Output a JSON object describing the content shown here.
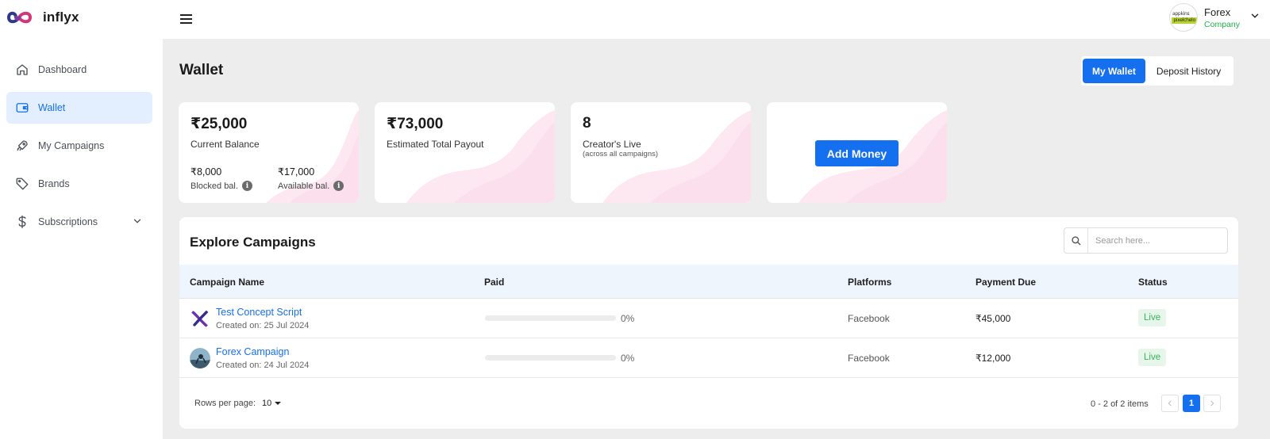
{
  "app": {
    "logo_text": "inflyx"
  },
  "sidebar": {
    "items": [
      {
        "label": "Dashboard",
        "icon": "home-icon"
      },
      {
        "label": "Wallet",
        "icon": "wallet-icon",
        "active": true
      },
      {
        "label": "My Campaigns",
        "icon": "rocket-icon"
      },
      {
        "label": "Brands",
        "icon": "tag-icon"
      },
      {
        "label": "Subscriptions",
        "icon": "dollar-icon",
        "expandable": true
      }
    ]
  },
  "user": {
    "name": "Forex",
    "role": "Company",
    "avatar_text_top": "appkins",
    "avatar_text_bottom": "pixelchelo"
  },
  "page": {
    "title": "Wallet",
    "tabs": [
      "My Wallet",
      "Deposit History"
    ],
    "active_tab": "My Wallet"
  },
  "stats": {
    "balance": {
      "amount": "₹25,000",
      "label": "Current Balance",
      "blocked_value": "₹8,000",
      "blocked_label": "Blocked bal.",
      "available_value": "₹17,000",
      "available_label": "Available bal."
    },
    "payout": {
      "amount": "₹73,000",
      "label": "Estimated Total Payout"
    },
    "creators": {
      "amount": "8",
      "label": "Creator's Live",
      "sub": "(across all campaigns)"
    },
    "add_money_label": "Add Money"
  },
  "campaigns": {
    "title": "Explore Campaigns",
    "search_placeholder": "Search here...",
    "columns": [
      "Campaign Name",
      "Paid",
      "Platforms",
      "Payment Due",
      "Status"
    ],
    "rows": [
      {
        "name": "Test Concept Script",
        "created": "Created on: 25 Jul 2024",
        "paid_pct": "0%",
        "paid_fraction": 0,
        "platform": "Facebook",
        "due": "₹45,000",
        "status": "Live"
      },
      {
        "name": "Forex Campaign",
        "created": "Created on: 24 Jul 2024",
        "paid_pct": "0%",
        "paid_fraction": 0,
        "platform": "Facebook",
        "due": "₹12,000",
        "status": "Live"
      }
    ],
    "rows_per_page_label": "Rows per page:",
    "rows_per_page": "10",
    "pager_info": "0 - 2  of 2 items",
    "current_page": "1"
  },
  "colors": {
    "accent": "#1570ef",
    "status_live_bg": "#e6f6ea",
    "status_live_fg": "#36b45a",
    "company_role": "#22b24c"
  }
}
